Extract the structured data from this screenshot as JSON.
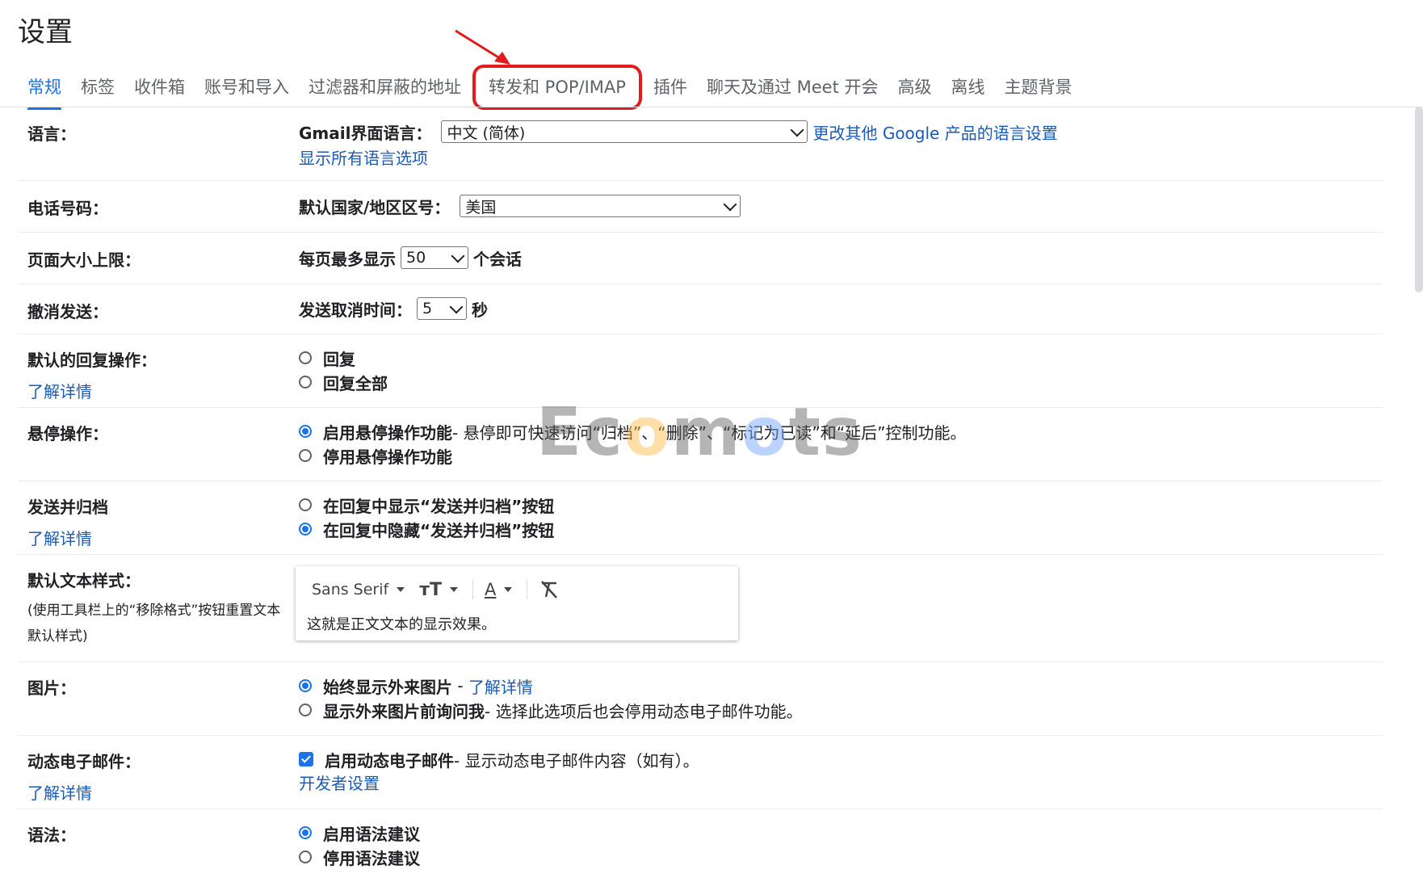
{
  "title": "设置",
  "tabs": [
    {
      "label": "常规",
      "active": true
    },
    {
      "label": "标签"
    },
    {
      "label": "收件箱"
    },
    {
      "label": "账号和导入"
    },
    {
      "label": "过滤器和屏蔽的地址"
    },
    {
      "label": "转发和 POP/IMAP",
      "highlighted": true
    },
    {
      "label": "插件"
    },
    {
      "label": "聊天及通过 Meet 开会"
    },
    {
      "label": "高级"
    },
    {
      "label": "离线"
    },
    {
      "label": "主题背景"
    }
  ],
  "language": {
    "label": "语言：",
    "field_label": "Gmail界面语言：",
    "value": "中文 (简体)",
    "other_link": "更改其他 Google 产品的语言设置",
    "show_all_link": "显示所有语言选项"
  },
  "phone": {
    "label": "电话号码：",
    "field_label": "默认国家/地区区号：",
    "value": "美国"
  },
  "page_size": {
    "label": "页面大小上限：",
    "prefix": "每页最多显示",
    "value": "50",
    "suffix": "个会话"
  },
  "undo_send": {
    "label": "撤消发送：",
    "prefix": "发送取消时间：",
    "value": "5",
    "suffix": "秒"
  },
  "reply": {
    "label": "默认的回复操作：",
    "learn_more": "了解详情",
    "options": [
      "回复",
      "回复全部"
    ]
  },
  "hover": {
    "label": "悬停操作：",
    "enable": "启用悬停操作功能",
    "enable_desc": " - 悬停即可快速访问“归档”、“删除”、“标记为已读”和“延后”控制功能。",
    "disable": "停用悬停操作功能"
  },
  "send_archive": {
    "label": "发送并归档",
    "learn_more": "了解详情",
    "show": "在回复中显示“发送并归档”按钮",
    "hide": "在回复中隐藏“发送并归档”按钮"
  },
  "text_style": {
    "label": "默认文本样式：",
    "sub": "(使用工具栏上的“移除格式”按钮重置文本默认样式)",
    "font": "Sans Serif",
    "size_glyph": "тT",
    "color_glyph": "A",
    "preview": "这就是正文文本的显示效果。"
  },
  "images": {
    "label": "图片：",
    "always": "始终显示外来图片",
    "always_link": "了解详情",
    "ask": "显示外来图片前询问我",
    "ask_desc": " - 选择此选项后也会停用动态电子邮件功能。"
  },
  "dynamic": {
    "label": "动态电子邮件：",
    "learn_more": "了解详情",
    "enable": "启用动态电子邮件",
    "enable_desc": " - 显示动态电子邮件内容（如有）。",
    "dev_link": "开发者设置"
  },
  "grammar": {
    "label": "语法：",
    "enable": "启用语法建议",
    "disable": "停用语法建议"
  },
  "watermark": {
    "p1": "Ec",
    "p2": "o",
    "p3": "m",
    "p4": "o",
    "p5": "ts"
  },
  "accent": "#1a73e8",
  "link_color": "#1a5ab8",
  "highlight_color": "#e21c1c"
}
